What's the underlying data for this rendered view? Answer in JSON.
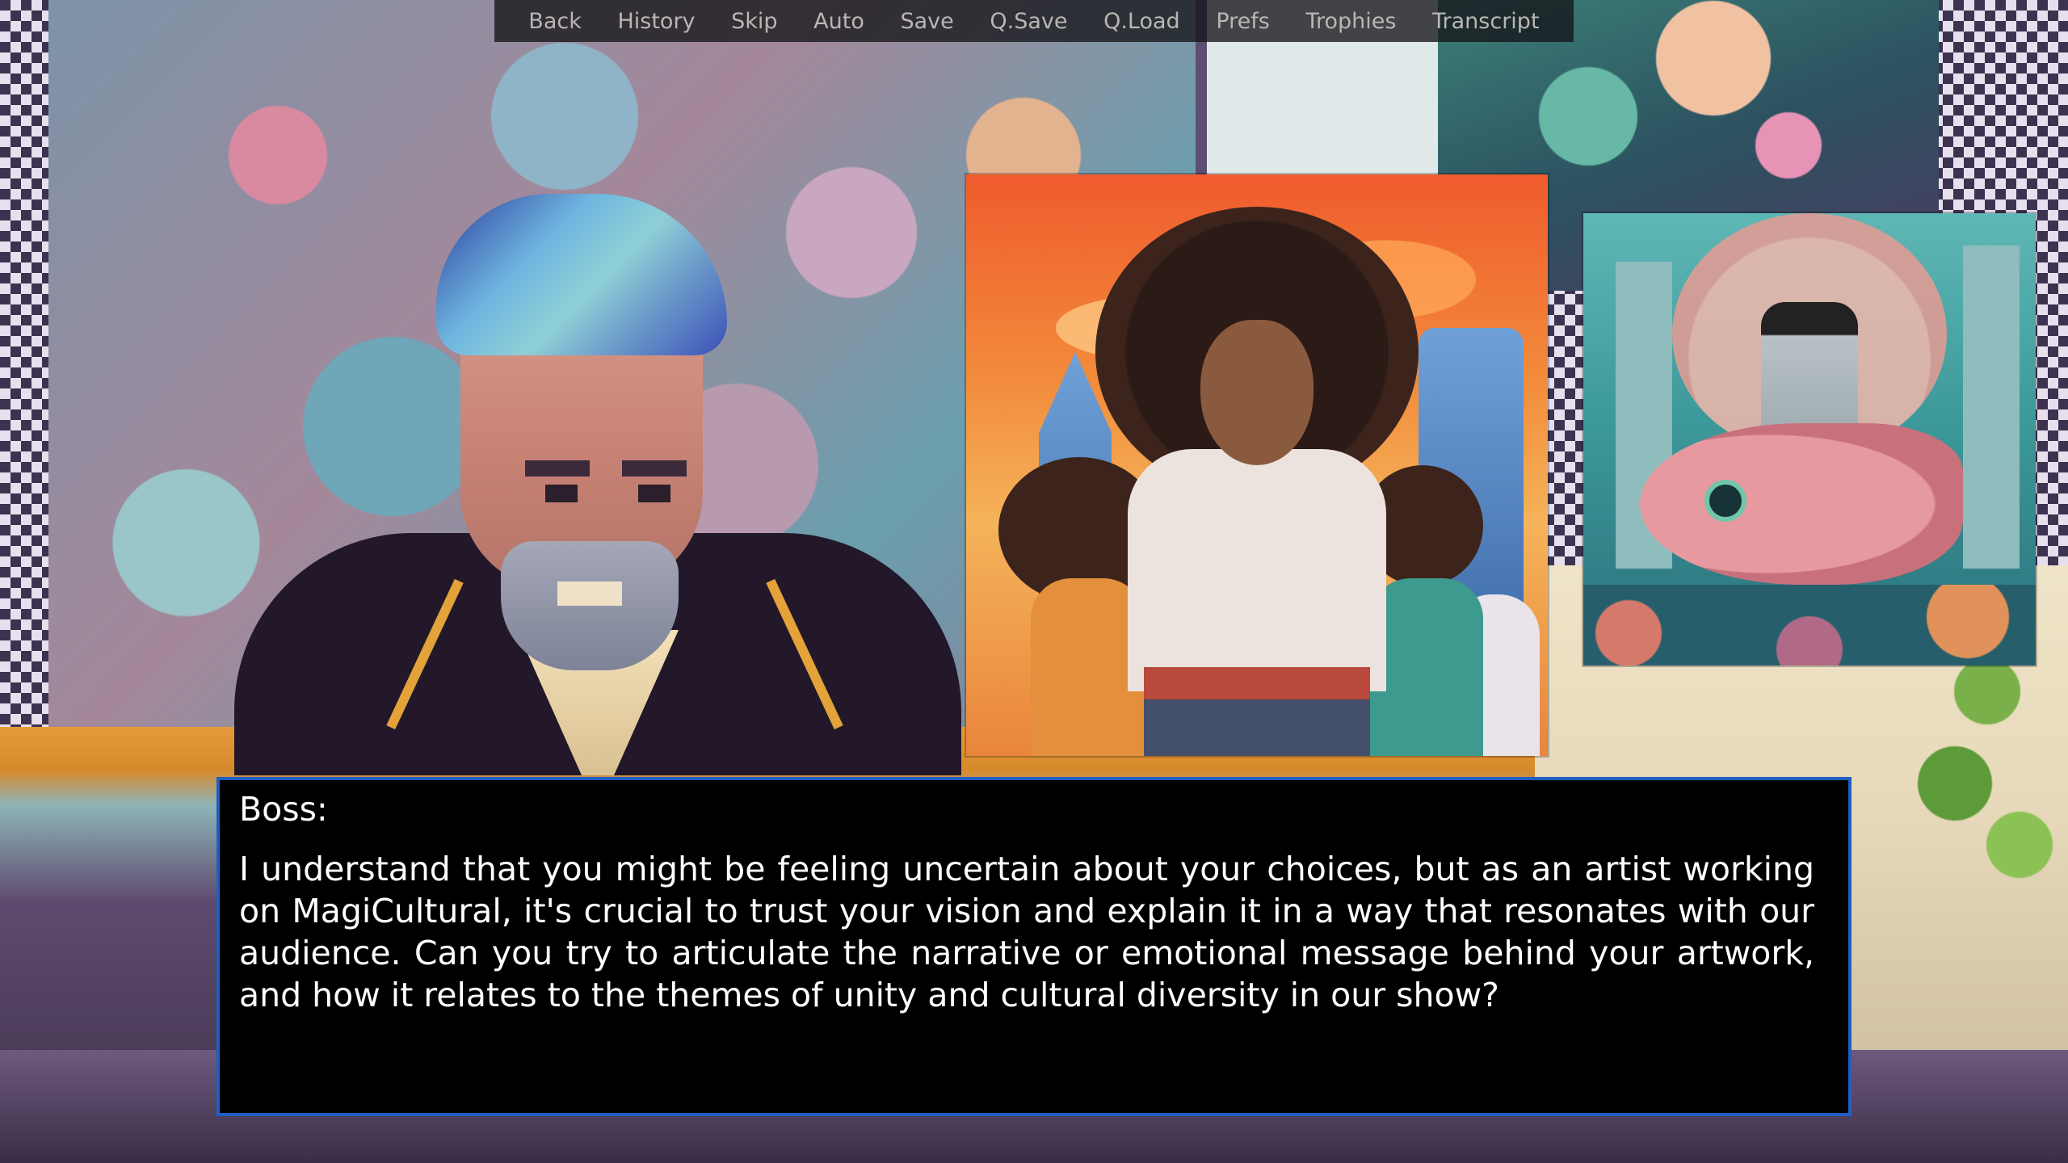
{
  "quick_menu": {
    "items": [
      {
        "label": "Back"
      },
      {
        "label": "History"
      },
      {
        "label": "Skip"
      },
      {
        "label": "Auto"
      },
      {
        "label": "Save"
      },
      {
        "label": "Q.Save"
      },
      {
        "label": "Q.Load"
      },
      {
        "label": "Prefs"
      },
      {
        "label": "Trophies"
      },
      {
        "label": "Transcript"
      }
    ]
  },
  "dialogue": {
    "speaker": "Boss:",
    "text": "I understand that you might be feeling uncertain about your choices, but as an artist working on MagiCultural, it's crucial to trust your vision and explain it in a way that resonates with our audience. Can you try to articulate the narrative or emotional message behind your artwork, and how it relates to the themes of unity and cultural diversity in our show?"
  },
  "colors": {
    "dialogue_border": "#1f5fc2",
    "dialogue_background": "#000000",
    "menu_text": "#b9b6b2"
  }
}
